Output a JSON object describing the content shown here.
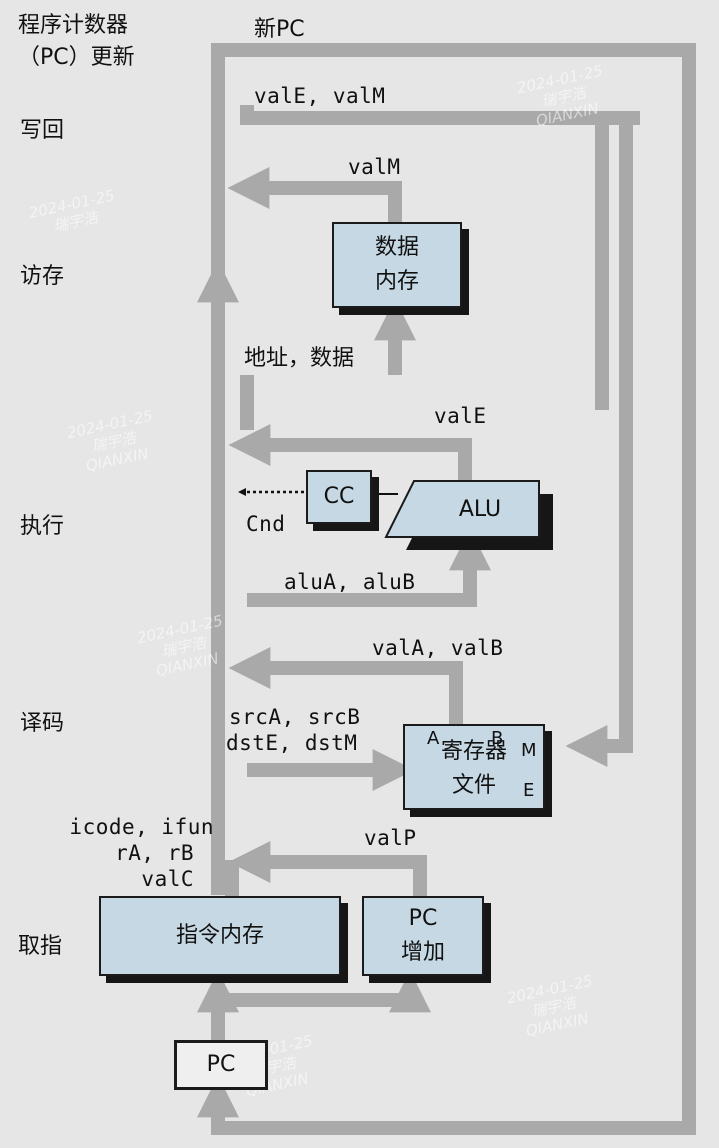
{
  "stages": {
    "pc_update": "程序计数器\n（PC）更新",
    "writeback": "写回",
    "memory": "访存",
    "execute": "执行",
    "decode": "译码",
    "fetch": "取指"
  },
  "signals": {
    "new_pc": "新PC",
    "vale_valm": "valE, valM",
    "valm": "valM",
    "addr_data": "地址，数据",
    "vale": "valE",
    "cnd": "Cnd",
    "alua_alub": "aluA, aluB",
    "vala_valb": "valA, valB",
    "srca_srcb": "srcA, srcB",
    "dste_dstm": "dstE, dstM",
    "icode_ifun": "icode, ifun",
    "ra_rb": "rA, rB",
    "valc": "valC",
    "valp": "valP"
  },
  "blocks": {
    "data_memory": "数据\n内存",
    "cc": "CC",
    "alu": "ALU",
    "register_file": "寄存器\n文件",
    "reg_port_a": "A",
    "reg_port_b": "B",
    "reg_port_m": "M",
    "reg_port_e": "E",
    "instruction_memory": "指令内存",
    "pc_increment": "PC\n增加",
    "pc": "PC"
  },
  "watermark": {
    "date": "2024-01-25",
    "name": "瑞宇浩",
    "org": "QIANXIN"
  },
  "colors": {
    "background": "#e6e6e6",
    "block_fill": "#c5d8e4",
    "wire": "#a9a9a9",
    "border": "#1b1b1b"
  }
}
